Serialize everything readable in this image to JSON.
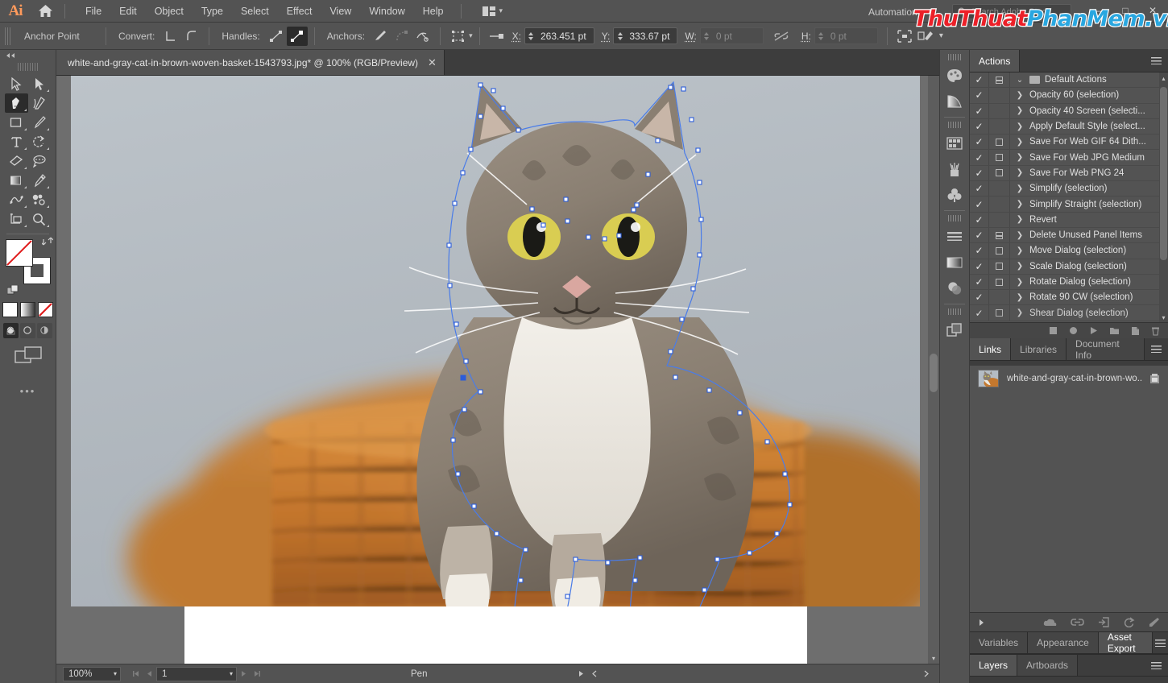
{
  "app": {
    "logo": "Ai",
    "home_icon": "home-icon",
    "arrange_icon": "arrange-documents-icon",
    "arrange_caret": "▾"
  },
  "menu": {
    "items": [
      {
        "label": "File"
      },
      {
        "label": "Edit"
      },
      {
        "label": "Object"
      },
      {
        "label": "Type"
      },
      {
        "label": "Select"
      },
      {
        "label": "Effect"
      },
      {
        "label": "View"
      },
      {
        "label": "Window"
      },
      {
        "label": "Help"
      }
    ]
  },
  "titlebar": {
    "automation_label": "Automation",
    "stock_placeholder": "Search Adobe Stock",
    "search_icon": "search-icon",
    "minimize": "—",
    "maximize": "□",
    "close": "✕"
  },
  "watermark": {
    "part1": "ThuThuat",
    "part2": "PhanMem",
    "part3": ".vn"
  },
  "workspace": {
    "grid_icon": "arrange-grid-icon",
    "switcher_icon": "workspace-switcher-icon",
    "caret": "▾",
    "menu_icon": "panel-list-icon"
  },
  "controlbar": {
    "title": "Anchor Point",
    "convert_label": "Convert:",
    "handles_label": "Handles:",
    "anchors_label": "Anchors:",
    "convert_corner_icon": "convert-to-corner-icon",
    "convert_smooth_icon": "convert-to-smooth-icon",
    "handles_show_icon": "show-handles-icon",
    "handles_hide_icon": "hide-handles-icon",
    "anchor_remove_icon": "remove-anchor-icon",
    "anchor_connect_icon": "connect-anchors-icon",
    "anchor_cut_icon": "cut-path-icon",
    "align_icon": "align-objects-icon",
    "align_caret": "▾",
    "transform_icon": "transform-icon",
    "x_label": "X:",
    "x_value": "263.451 pt",
    "y_label": "Y:",
    "y_value": "333.67 pt",
    "w_label": "W:",
    "w_value": "0 pt",
    "h_label": "H:",
    "h_value": "0 pt",
    "link_icon": "constrain-proportions-off-icon",
    "isolate_icon": "isolate-selected-icon",
    "edit_icon": "edit-toolbar-icon",
    "overflow_caret": "▾"
  },
  "toolbar": {
    "collapse_icon": "collapse-panel-icon",
    "tools": [
      {
        "name": "selection-tool",
        "icon": "selection-arrow-icon",
        "active": false
      },
      {
        "name": "direct-selection-tool",
        "icon": "direct-selection-arrow-icon",
        "active": false
      },
      {
        "name": "pen-tool",
        "icon": "pen-icon",
        "active": true
      },
      {
        "name": "curvature-tool",
        "icon": "curvature-icon",
        "active": false
      },
      {
        "name": "rectangle-tool",
        "icon": "rectangle-icon",
        "active": false
      },
      {
        "name": "paintbrush-tool",
        "icon": "paintbrush-icon",
        "active": false
      },
      {
        "name": "type-tool",
        "icon": "type-t-icon",
        "active": false
      },
      {
        "name": "rotate-tool",
        "icon": "rotate-icon",
        "active": false
      },
      {
        "name": "eraser-tool",
        "icon": "eraser-icon",
        "active": false
      },
      {
        "name": "lasso-tool",
        "icon": "lasso-icon",
        "active": false
      },
      {
        "name": "gradient-tool",
        "icon": "gradient-icon",
        "active": false
      },
      {
        "name": "eyedropper-tool",
        "icon": "eyedropper-icon",
        "active": false
      },
      {
        "name": "blend-tool",
        "icon": "blend-icon",
        "active": false
      },
      {
        "name": "symbol-sprayer-tool",
        "icon": "symbol-sprayer-icon",
        "active": false
      },
      {
        "name": "artboard-tool",
        "icon": "artboard-icon",
        "active": false
      },
      {
        "name": "zoom-tool",
        "icon": "magnifier-icon",
        "active": false
      }
    ],
    "fill_color": "#ffffff",
    "stroke_color": "#ffffff",
    "none_indicator_color": "#e01b1b",
    "swap_icon": "swap-fill-stroke-icon",
    "default_icon": "default-fill-stroke-icon",
    "color_modes": [
      {
        "name": "color-mode-flat",
        "icon": "flat-color-icon"
      },
      {
        "name": "color-mode-gradient",
        "icon": "gradient-swatch-icon"
      },
      {
        "name": "color-mode-none",
        "icon": "none-swatch-icon"
      }
    ],
    "draw_modes": [
      {
        "name": "draw-normal",
        "icon": "draw-normal-icon",
        "selected": true
      },
      {
        "name": "draw-behind",
        "icon": "draw-behind-icon",
        "selected": false
      },
      {
        "name": "draw-inside",
        "icon": "draw-inside-icon",
        "selected": false
      }
    ],
    "screen_mode_icon": "change-screen-mode-icon",
    "overflow": "•••"
  },
  "document": {
    "tab_title": "white-and-gray-cat-in-brown-woven-basket-1543793.jpg* @ 100% (RGB/Preview)",
    "close_icon": "✕"
  },
  "canvas": {
    "path_selection": "pen-path-anchor-points",
    "anchor_color": "#2b5cd9"
  },
  "statusbar": {
    "zoom_level": "100%",
    "zoom_caret": "▾",
    "first_icon": "first-artboard-icon",
    "prev_icon": "previous-artboard-icon",
    "page_number": "1",
    "page_caret": "▾",
    "next_icon": "next-artboard-icon",
    "last_icon": "last-artboard-icon",
    "tool_status": "Pen",
    "play_icon": "status-play-icon",
    "collapse_icon": "status-collapse-icon"
  },
  "iconrail": {
    "items": [
      {
        "name": "color-panel-icon",
        "icon": "palette-icon"
      },
      {
        "name": "color-guide-panel-icon",
        "icon": "color-guide-icon"
      },
      {
        "name": "swatches-panel-icon",
        "icon": "swatches-grid-icon"
      },
      {
        "name": "brushes-panel-icon",
        "icon": "brushes-jar-icon"
      },
      {
        "name": "symbols-panel-icon",
        "icon": "clover-icon"
      },
      {
        "name": "stroke-panel-icon",
        "icon": "stroke-lines-icon"
      },
      {
        "name": "gradient-panel-icon",
        "icon": "gradient-bar-icon"
      },
      {
        "name": "transparency-panel-icon",
        "icon": "transparency-circles-icon"
      },
      {
        "name": "pathfinder-panel-icon",
        "icon": "pathfinder-shapes-icon"
      }
    ]
  },
  "actions_panel": {
    "tab_label": "Actions",
    "menu_icon": "panel-menu-icon",
    "set_name": "Default Actions",
    "set_expand_caret": "⌄",
    "set_folder_icon": "folder-icon",
    "items": [
      {
        "label": "Opacity 60 (selection)",
        "checked": true,
        "has_dialog_box": false
      },
      {
        "label": "Opacity 40 Screen (selecti...",
        "checked": true,
        "has_dialog_box": false
      },
      {
        "label": "Apply Default Style (select...",
        "checked": true,
        "has_dialog_box": false
      },
      {
        "label": "Save For Web GIF 64 Dith...",
        "checked": true,
        "has_dialog_box": true
      },
      {
        "label": "Save For Web JPG Medium",
        "checked": true,
        "has_dialog_box": true
      },
      {
        "label": "Save For Web PNG 24",
        "checked": true,
        "has_dialog_box": true
      },
      {
        "label": "Simplify (selection)",
        "checked": true,
        "has_dialog_box": false
      },
      {
        "label": "Simplify Straight (selection)",
        "checked": true,
        "has_dialog_box": false
      },
      {
        "label": "Revert",
        "checked": true,
        "has_dialog_box": false
      },
      {
        "label": "Delete Unused Panel Items",
        "checked": true,
        "has_dialog_box": true
      },
      {
        "label": "Move Dialog (selection)",
        "checked": true,
        "has_dialog_box": true
      },
      {
        "label": "Scale Dialog (selection)",
        "checked": true,
        "has_dialog_box": true
      },
      {
        "label": "Rotate Dialog (selection)",
        "checked": true,
        "has_dialog_box": true
      },
      {
        "label": "Rotate 90 CW (selection)",
        "checked": true,
        "has_dialog_box": false
      },
      {
        "label": "Shear Dialog (selection)",
        "checked": true,
        "has_dialog_box": true
      }
    ],
    "footer_icons": [
      {
        "name": "stop-playing-button",
        "icon": "stop-square-icon"
      },
      {
        "name": "begin-recording-button",
        "icon": "record-circle-icon"
      },
      {
        "name": "play-selection-button",
        "icon": "play-triangle-icon"
      },
      {
        "name": "create-new-set-button",
        "icon": "folder-icon"
      },
      {
        "name": "create-new-action-button",
        "icon": "new-page-icon"
      },
      {
        "name": "delete-selection-button",
        "icon": "trash-icon"
      }
    ]
  },
  "links_panel": {
    "tabs": [
      {
        "label": "Links",
        "active": true
      },
      {
        "label": "Libraries",
        "active": false
      },
      {
        "label": "Document Info",
        "active": false
      }
    ],
    "menu_icon": "panel-menu-icon",
    "link_name": "white-and-gray-cat-in-brown-wo...",
    "link_status_icon": "embedded-link-icon",
    "footer_icons": [
      {
        "name": "expand-link-info-button",
        "icon": "triangle-right-icon"
      },
      {
        "name": "relink-from-cc-libraries-button",
        "icon": "cloud-link-icon"
      },
      {
        "name": "relink-button",
        "icon": "chain-link-icon"
      },
      {
        "name": "go-to-link-button",
        "icon": "goto-link-icon"
      },
      {
        "name": "update-link-button",
        "icon": "refresh-icon"
      },
      {
        "name": "edit-original-button",
        "icon": "pencil-icon"
      }
    ]
  },
  "bottom_panels": {
    "row1": [
      {
        "label": "Variables",
        "active": false
      },
      {
        "label": "Appearance",
        "active": false
      },
      {
        "label": "Asset Export",
        "active": true
      }
    ],
    "row1_menu_icon": "panel-menu-icon",
    "row2": [
      {
        "label": "Layers",
        "active": true
      },
      {
        "label": "Artboards",
        "active": false
      }
    ],
    "row2_menu_icon": "panel-menu-icon"
  },
  "colors": {
    "chrome": "#535353",
    "panel_bg": "#3d3d3d",
    "canvas_bg": "#6e6e6e",
    "artboard_bg": "#b4bcc4",
    "accent_orange": "#ff9a5c",
    "anchor_blue": "#2b5cd9"
  }
}
